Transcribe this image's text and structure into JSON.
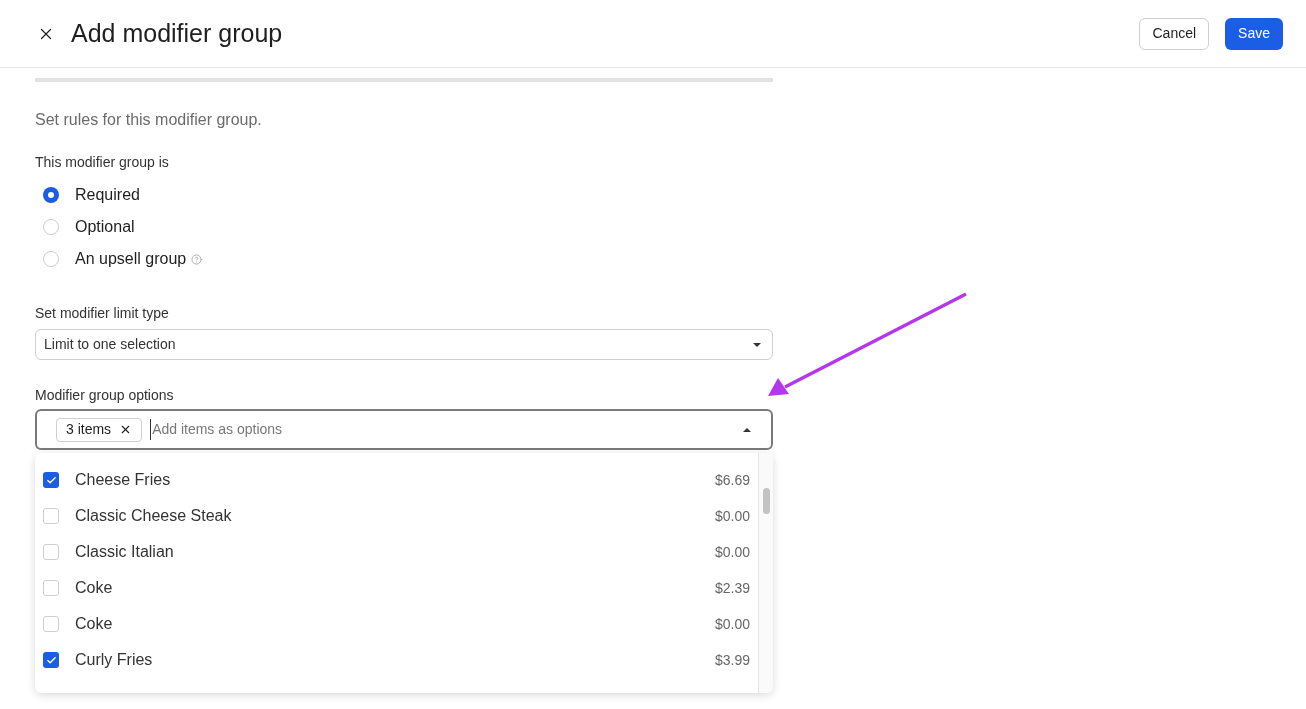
{
  "header": {
    "title": "Add modifier group",
    "buttons": [
      {
        "label": "Cancel",
        "kind": "secondary"
      },
      {
        "label": "Save",
        "kind": "primary"
      }
    ]
  },
  "rules": {
    "description": "Set rules for this modifier group.",
    "group_type": {
      "label": "This modifier group is",
      "options": [
        {
          "label": "Required",
          "selected": true,
          "help": false
        },
        {
          "label": "Optional",
          "selected": false,
          "help": false
        },
        {
          "label": "An upsell group",
          "selected": false,
          "help": true
        }
      ]
    },
    "limit_type": {
      "label": "Set modifier limit type",
      "value": "Limit to one selection"
    },
    "options_field": {
      "label": "Modifier group options",
      "chip": "3 items",
      "placeholder": "Add items as options",
      "expanded": true,
      "items": [
        {
          "name": "Cheese Fries",
          "price": "$6.69",
          "checked": true
        },
        {
          "name": "Classic Cheese Steak",
          "price": "$0.00",
          "checked": false
        },
        {
          "name": "Classic Italian",
          "price": "$0.00",
          "checked": false
        },
        {
          "name": "Coke",
          "price": "$2.39",
          "checked": false
        },
        {
          "name": "Coke",
          "price": "$0.00",
          "checked": false
        },
        {
          "name": "Curly Fries",
          "price": "$3.99",
          "checked": true
        }
      ]
    }
  }
}
